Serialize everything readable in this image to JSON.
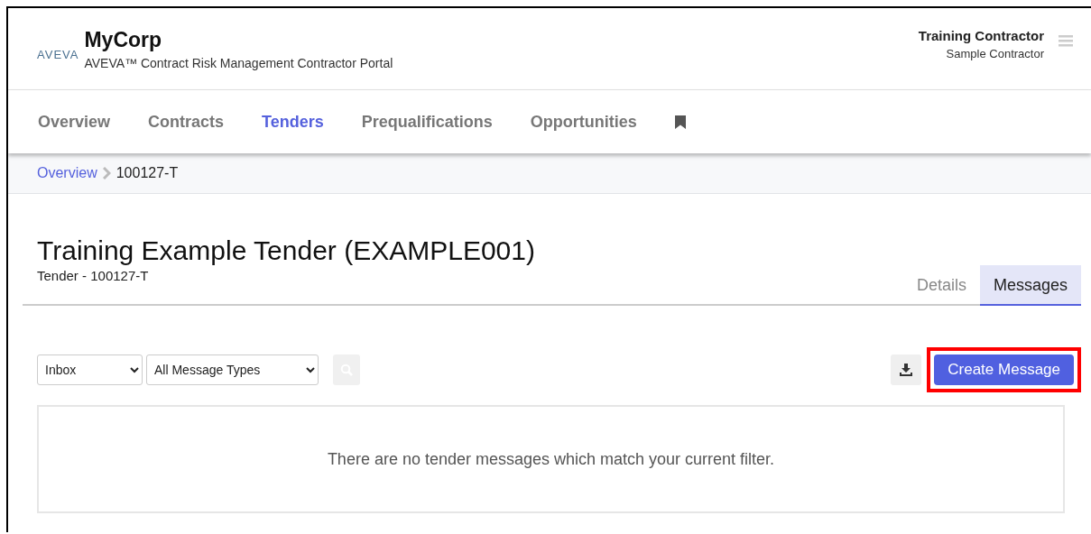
{
  "header": {
    "logo": "AVEVA",
    "company": "MyCorp",
    "subtitle": "AVEVA™ Contract Risk Management Contractor Portal",
    "user_name": "Training Contractor",
    "user_org": "Sample Contractor"
  },
  "nav": [
    {
      "label": "Overview",
      "selected": false
    },
    {
      "label": "Contracts",
      "selected": false
    },
    {
      "label": "Tenders",
      "selected": true
    },
    {
      "label": "Prequalifications",
      "selected": false
    },
    {
      "label": "Opportunities",
      "selected": false
    }
  ],
  "breadcrumb": [
    {
      "label": "Overview",
      "kind": "link"
    },
    {
      "label": "100127-T",
      "kind": "current"
    }
  ],
  "page": {
    "title": "Training Example Tender (EXAMPLE001)",
    "subtitle": "Tender - 100127-T"
  },
  "tabs": [
    {
      "label": "Details",
      "selected": false
    },
    {
      "label": "Messages",
      "selected": true
    }
  ],
  "filters": [
    {
      "value": "Inbox"
    },
    {
      "value": "All Message Types"
    }
  ],
  "create_button": {
    "label": "Create Message",
    "highlighted": true
  },
  "empty_message": "There are no tender messages which match your current filter."
}
